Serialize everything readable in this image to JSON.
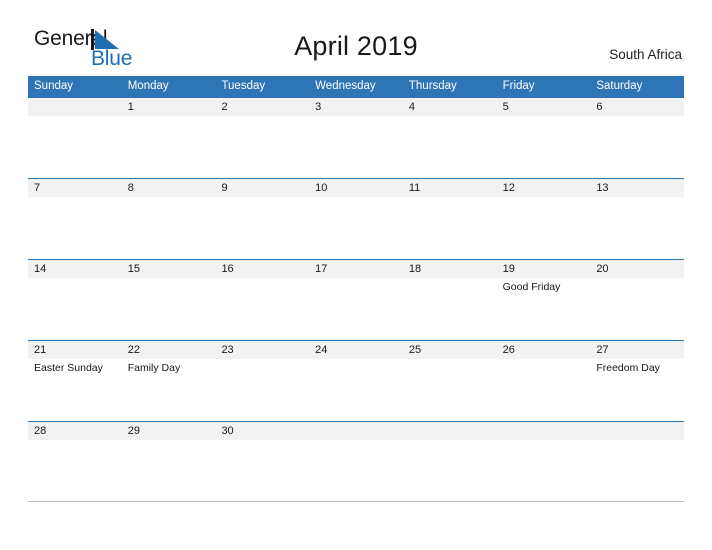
{
  "brand": {
    "name_part1": "General",
    "name_part2": "Blue",
    "mark_icon": "triangle-flag-icon",
    "accent_color": "#1f6fb2"
  },
  "header": {
    "title": "April 2019",
    "region": "South Africa"
  },
  "calendar": {
    "month": "April",
    "year": "2019",
    "header_color": "#2e75b6",
    "row_separator_color": "#2e75b6",
    "date_band_color": "#f2f2f2",
    "weekdays": [
      "Sunday",
      "Monday",
      "Tuesday",
      "Wednesday",
      "Thursday",
      "Friday",
      "Saturday"
    ],
    "weeks": [
      [
        {
          "date": "",
          "events": []
        },
        {
          "date": "1",
          "events": []
        },
        {
          "date": "2",
          "events": []
        },
        {
          "date": "3",
          "events": []
        },
        {
          "date": "4",
          "events": []
        },
        {
          "date": "5",
          "events": []
        },
        {
          "date": "6",
          "events": []
        }
      ],
      [
        {
          "date": "7",
          "events": []
        },
        {
          "date": "8",
          "events": []
        },
        {
          "date": "9",
          "events": []
        },
        {
          "date": "10",
          "events": []
        },
        {
          "date": "11",
          "events": []
        },
        {
          "date": "12",
          "events": []
        },
        {
          "date": "13",
          "events": []
        }
      ],
      [
        {
          "date": "14",
          "events": []
        },
        {
          "date": "15",
          "events": []
        },
        {
          "date": "16",
          "events": []
        },
        {
          "date": "17",
          "events": []
        },
        {
          "date": "18",
          "events": []
        },
        {
          "date": "19",
          "events": [
            "Good Friday"
          ]
        },
        {
          "date": "20",
          "events": []
        }
      ],
      [
        {
          "date": "21",
          "events": [
            "Easter Sunday"
          ]
        },
        {
          "date": "22",
          "events": [
            "Family Day"
          ]
        },
        {
          "date": "23",
          "events": []
        },
        {
          "date": "24",
          "events": []
        },
        {
          "date": "25",
          "events": []
        },
        {
          "date": "26",
          "events": []
        },
        {
          "date": "27",
          "events": [
            "Freedom Day"
          ]
        }
      ],
      [
        {
          "date": "28",
          "events": []
        },
        {
          "date": "29",
          "events": []
        },
        {
          "date": "30",
          "events": []
        },
        {
          "date": "",
          "events": []
        },
        {
          "date": "",
          "events": []
        },
        {
          "date": "",
          "events": []
        },
        {
          "date": "",
          "events": []
        }
      ]
    ]
  }
}
